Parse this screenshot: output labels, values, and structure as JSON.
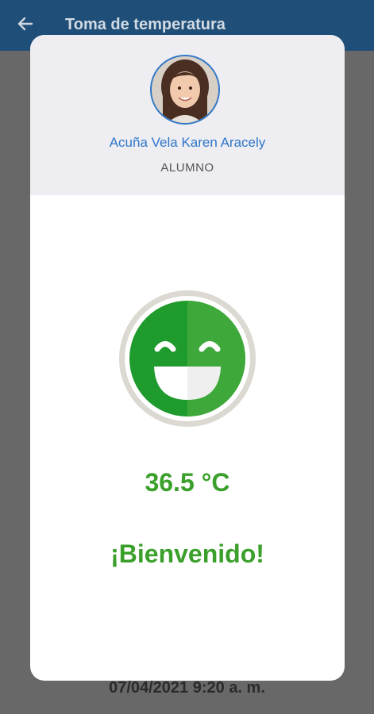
{
  "appbar": {
    "title": "Toma de temperatura",
    "back_icon": "arrow-left-icon"
  },
  "background": {
    "datetime": "07/04/2021 9:20 a. m."
  },
  "dialog": {
    "student_name": "Acuña Vela Karen Aracely",
    "role": "ALUMNO",
    "status_icon": "happy-face-icon",
    "temperature": "36.5 °C",
    "message": "¡Bienvenido!"
  },
  "colors": {
    "appbar": "#1f4e78",
    "accent_blue": "#2f77c7",
    "success_green": "#3ba02b",
    "header_bg": "#ededf2"
  }
}
